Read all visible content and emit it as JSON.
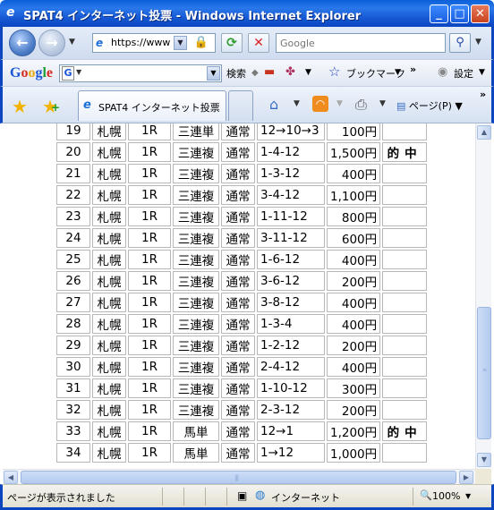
{
  "window": {
    "title": "SPAT4 インターネット投票 - Windows Internet Explorer",
    "min": "_",
    "max": "□",
    "close": "✕"
  },
  "navbar": {
    "back": "←",
    "forward": "→",
    "url": "https://www",
    "search_placeholder": "Google"
  },
  "google_bar": {
    "logo": [
      "G",
      "o",
      "o",
      "g",
      "l",
      "e"
    ],
    "search_label": "検索",
    "bookmarks_label": "ブックマーク",
    "settings_label": "設定"
  },
  "tabbar": {
    "tab_title": "SPAT4 インターネット投票",
    "page_label": "ページ(P)"
  },
  "table": {
    "rows": [
      {
        "no": "19",
        "place": "札幌",
        "race": "1R",
        "bet": "三連単",
        "type": "通常",
        "combo": "12→10→3",
        "amount": "100円",
        "result": ""
      },
      {
        "no": "20",
        "place": "札幌",
        "race": "1R",
        "bet": "三連複",
        "type": "通常",
        "combo": "1-4-12",
        "amount": "1,500円",
        "result": "的中"
      },
      {
        "no": "21",
        "place": "札幌",
        "race": "1R",
        "bet": "三連複",
        "type": "通常",
        "combo": "1-3-12",
        "amount": "400円",
        "result": ""
      },
      {
        "no": "22",
        "place": "札幌",
        "race": "1R",
        "bet": "三連複",
        "type": "通常",
        "combo": "3-4-12",
        "amount": "1,100円",
        "result": ""
      },
      {
        "no": "23",
        "place": "札幌",
        "race": "1R",
        "bet": "三連複",
        "type": "通常",
        "combo": "1-11-12",
        "amount": "800円",
        "result": ""
      },
      {
        "no": "24",
        "place": "札幌",
        "race": "1R",
        "bet": "三連複",
        "type": "通常",
        "combo": "3-11-12",
        "amount": "600円",
        "result": ""
      },
      {
        "no": "25",
        "place": "札幌",
        "race": "1R",
        "bet": "三連複",
        "type": "通常",
        "combo": "1-6-12",
        "amount": "400円",
        "result": ""
      },
      {
        "no": "26",
        "place": "札幌",
        "race": "1R",
        "bet": "三連複",
        "type": "通常",
        "combo": "3-6-12",
        "amount": "200円",
        "result": ""
      },
      {
        "no": "27",
        "place": "札幌",
        "race": "1R",
        "bet": "三連複",
        "type": "通常",
        "combo": "3-8-12",
        "amount": "400円",
        "result": ""
      },
      {
        "no": "28",
        "place": "札幌",
        "race": "1R",
        "bet": "三連複",
        "type": "通常",
        "combo": "1-3-4",
        "amount": "400円",
        "result": ""
      },
      {
        "no": "29",
        "place": "札幌",
        "race": "1R",
        "bet": "三連複",
        "type": "通常",
        "combo": "1-2-12",
        "amount": "200円",
        "result": ""
      },
      {
        "no": "30",
        "place": "札幌",
        "race": "1R",
        "bet": "三連複",
        "type": "通常",
        "combo": "2-4-12",
        "amount": "400円",
        "result": ""
      },
      {
        "no": "31",
        "place": "札幌",
        "race": "1R",
        "bet": "三連複",
        "type": "通常",
        "combo": "1-10-12",
        "amount": "300円",
        "result": ""
      },
      {
        "no": "32",
        "place": "札幌",
        "race": "1R",
        "bet": "三連複",
        "type": "通常",
        "combo": "2-3-12",
        "amount": "200円",
        "result": ""
      },
      {
        "no": "33",
        "place": "札幌",
        "race": "1R",
        "bet": "馬単",
        "type": "通常",
        "combo": "12→1",
        "amount": "1,200円",
        "result": "的中"
      },
      {
        "no": "34",
        "place": "札幌",
        "race": "1R",
        "bet": "馬単",
        "type": "通常",
        "combo": "1→12",
        "amount": "1,000円",
        "result": ""
      }
    ]
  },
  "statusbar": {
    "message": "ページが表示されました",
    "zone": "インターネット",
    "zoom": "100%"
  },
  "colors": {
    "hit": "#e8000b",
    "titlebar": "#0b46c0"
  }
}
